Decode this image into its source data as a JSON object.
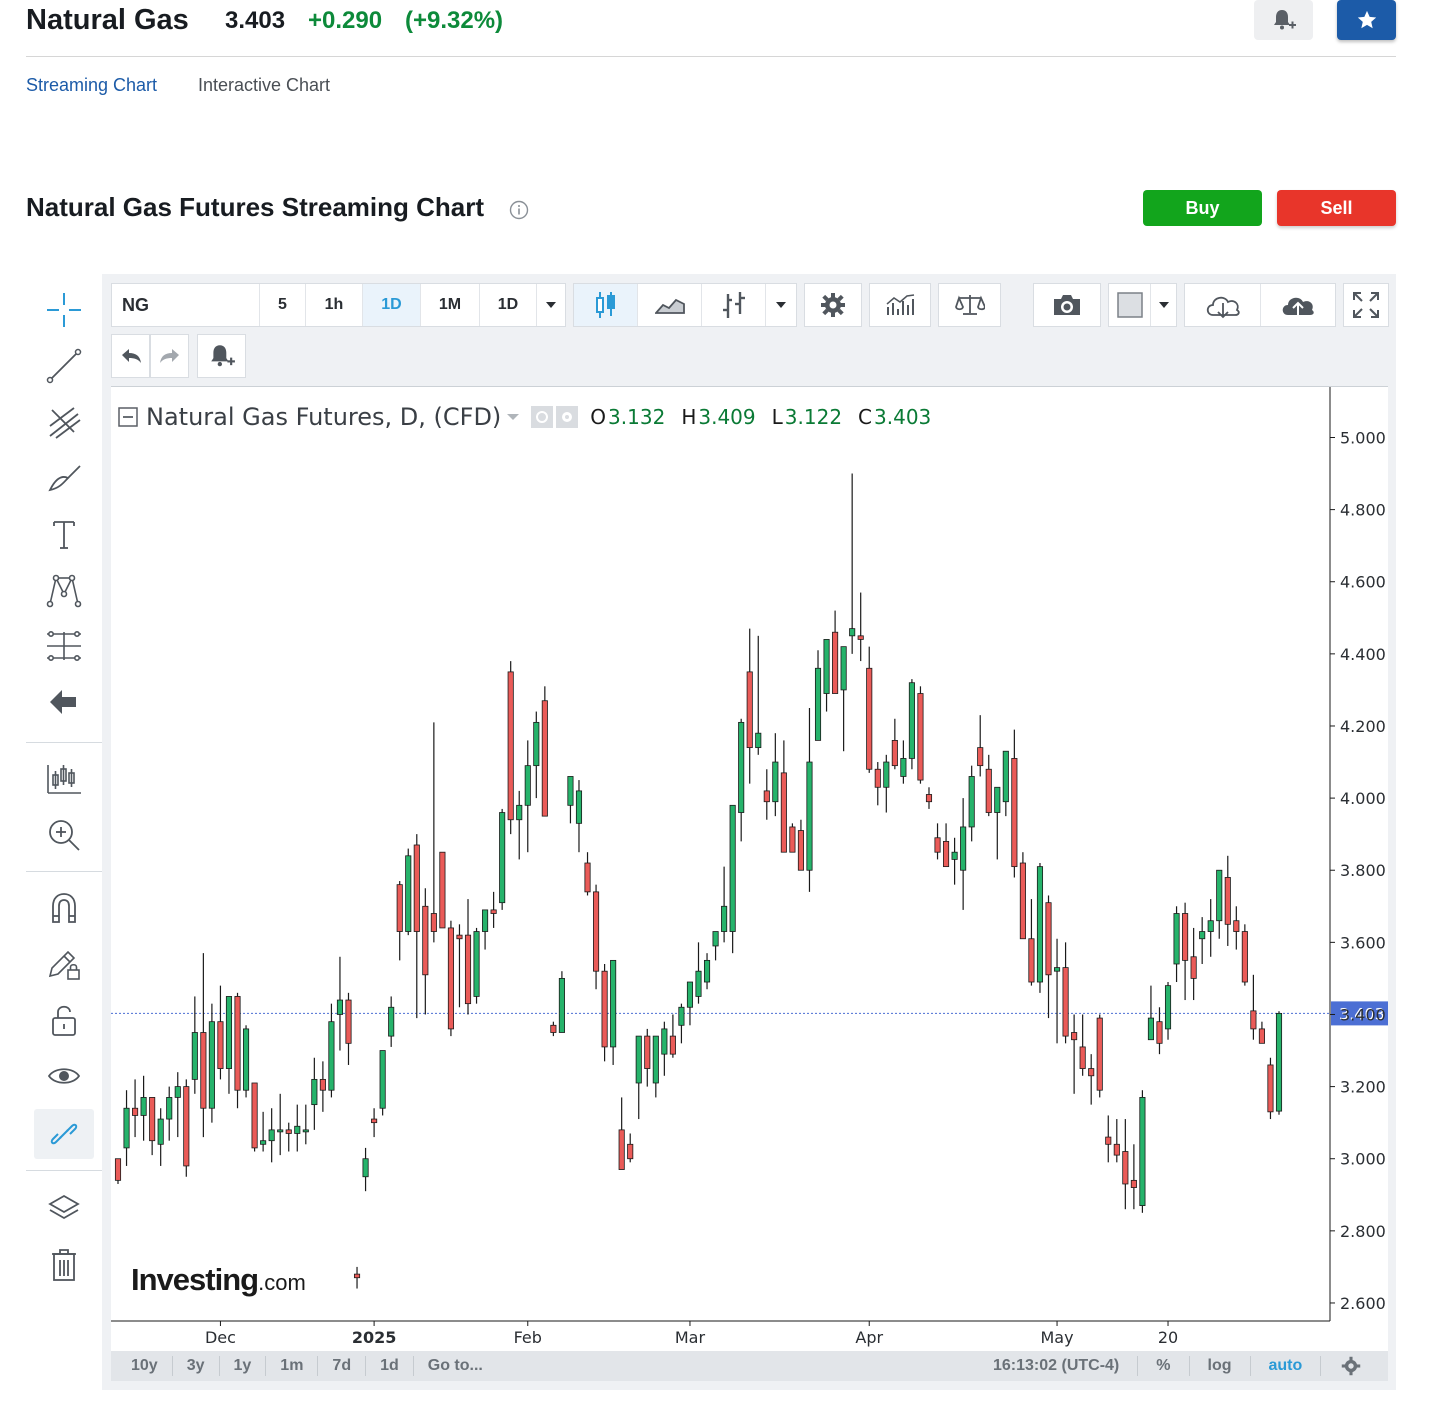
{
  "header": {
    "title": "Natural Gas",
    "price": "3.403",
    "change": "+0.290",
    "change_pct": "(+9.32%)"
  },
  "tabs": [
    {
      "label": "Streaming Chart",
      "active": true
    },
    {
      "label": "Interactive Chart",
      "active": false
    }
  ],
  "section": {
    "title": "Natural Gas Futures Streaming Chart",
    "buy_label": "Buy",
    "sell_label": "Sell"
  },
  "toolbar": {
    "symbol": "NG",
    "intervals": [
      "5",
      "1h",
      "1D",
      "1M",
      "1D"
    ],
    "active_interval": "1D"
  },
  "legend": {
    "title": "Natural Gas Futures, D, (CFD)",
    "o_label": "O",
    "o_value": "3.132",
    "h_label": "H",
    "h_value": "3.409",
    "l_label": "L",
    "l_value": "3.122",
    "c_label": "C",
    "c_value": "3.403"
  },
  "chart_data": {
    "type": "candlestick",
    "y_ticks": [
      "5.000",
      "4.800",
      "4.600",
      "4.400",
      "4.200",
      "4.000",
      "3.800",
      "3.600",
      "3.400",
      "3.200",
      "3.000",
      "2.800",
      "2.600"
    ],
    "x_ticks": [
      "Dec",
      "2025",
      "Feb",
      "Mar",
      "Apr",
      "May",
      "20"
    ],
    "ylim": [
      2.55,
      5.14
    ],
    "last_price": "3.403",
    "colors": {
      "up": "#26b36b",
      "down": "#ea5b58",
      "price_line": "#4c6fd4"
    },
    "candles": [
      {
        "o": 3.0,
        "h": 3.0,
        "l": 2.93,
        "c": 2.94
      },
      {
        "o": 3.03,
        "h": 3.19,
        "l": 2.98,
        "c": 3.14
      },
      {
        "o": 3.14,
        "h": 3.22,
        "l": 3.06,
        "c": 3.12
      },
      {
        "o": 3.12,
        "h": 3.23,
        "l": 3.05,
        "c": 3.17
      },
      {
        "o": 3.17,
        "h": 3.17,
        "l": 3.01,
        "c": 3.05
      },
      {
        "o": 3.04,
        "h": 3.14,
        "l": 2.98,
        "c": 3.11
      },
      {
        "o": 3.11,
        "h": 3.2,
        "l": 3.05,
        "c": 3.17
      },
      {
        "o": 3.17,
        "h": 3.24,
        "l": 3.06,
        "c": 3.2
      },
      {
        "o": 3.2,
        "h": 3.22,
        "l": 2.95,
        "c": 2.98
      },
      {
        "o": 3.22,
        "h": 3.45,
        "l": 3.18,
        "c": 3.35
      },
      {
        "o": 3.35,
        "h": 3.57,
        "l": 3.06,
        "c": 3.14
      },
      {
        "o": 3.14,
        "h": 3.43,
        "l": 3.1,
        "c": 3.38
      },
      {
        "o": 3.38,
        "h": 3.48,
        "l": 3.22,
        "c": 3.25
      },
      {
        "o": 3.25,
        "h": 3.45,
        "l": 3.18,
        "c": 3.45
      },
      {
        "o": 3.45,
        "h": 3.46,
        "l": 3.14,
        "c": 3.19
      },
      {
        "o": 3.19,
        "h": 3.37,
        "l": 3.17,
        "c": 3.36
      },
      {
        "o": 3.21,
        "h": 3.21,
        "l": 3.02,
        "c": 3.03
      },
      {
        "o": 3.04,
        "h": 3.13,
        "l": 3.02,
        "c": 3.05
      },
      {
        "o": 3.05,
        "h": 3.14,
        "l": 2.99,
        "c": 3.08
      },
      {
        "o": 3.08,
        "h": 3.18,
        "l": 3.01,
        "c": 3.08
      },
      {
        "o": 3.08,
        "h": 3.1,
        "l": 3.02,
        "c": 3.07
      },
      {
        "o": 3.07,
        "h": 3.15,
        "l": 3.02,
        "c": 3.09
      },
      {
        "o": 3.08,
        "h": 3.15,
        "l": 3.04,
        "c": 3.08
      },
      {
        "o": 3.15,
        "h": 3.28,
        "l": 3.08,
        "c": 3.22
      },
      {
        "o": 3.22,
        "h": 3.27,
        "l": 3.13,
        "c": 3.19
      },
      {
        "o": 3.19,
        "h": 3.43,
        "l": 3.17,
        "c": 3.38
      },
      {
        "o": 3.4,
        "h": 3.56,
        "l": 3.3,
        "c": 3.44
      },
      {
        "o": 3.44,
        "h": 3.46,
        "l": 3.26,
        "c": 3.32
      },
      {
        "o": 2.68,
        "h": 2.7,
        "l": 2.64,
        "c": 2.67
      },
      {
        "o": 2.95,
        "h": 3.03,
        "l": 2.91,
        "c": 3.0
      },
      {
        "o": 3.11,
        "h": 3.14,
        "l": 3.06,
        "c": 3.1
      },
      {
        "o": 3.14,
        "h": 3.3,
        "l": 3.12,
        "c": 3.3
      },
      {
        "o": 3.34,
        "h": 3.45,
        "l": 3.31,
        "c": 3.42
      },
      {
        "o": 3.76,
        "h": 3.77,
        "l": 3.55,
        "c": 3.63
      },
      {
        "o": 3.63,
        "h": 3.86,
        "l": 3.62,
        "c": 3.84
      },
      {
        "o": 3.87,
        "h": 3.9,
        "l": 3.39,
        "c": 3.63
      },
      {
        "o": 3.7,
        "h": 3.75,
        "l": 3.4,
        "c": 3.51
      },
      {
        "o": 3.68,
        "h": 4.21,
        "l": 3.6,
        "c": 3.63
      },
      {
        "o": 3.85,
        "h": 3.85,
        "l": 3.66,
        "c": 3.64
      },
      {
        "o": 3.64,
        "h": 3.66,
        "l": 3.34,
        "c": 3.36
      },
      {
        "o": 3.62,
        "h": 3.65,
        "l": 3.42,
        "c": 3.61
      },
      {
        "o": 3.62,
        "h": 3.72,
        "l": 3.4,
        "c": 3.43
      },
      {
        "o": 3.45,
        "h": 3.64,
        "l": 3.43,
        "c": 3.63
      },
      {
        "o": 3.63,
        "h": 3.64,
        "l": 3.58,
        "c": 3.69
      },
      {
        "o": 3.69,
        "h": 3.74,
        "l": 3.64,
        "c": 3.68
      },
      {
        "o": 3.71,
        "h": 3.97,
        "l": 3.69,
        "c": 3.96
      },
      {
        "o": 4.35,
        "h": 4.38,
        "l": 3.9,
        "c": 3.94
      },
      {
        "o": 3.94,
        "h": 4.02,
        "l": 3.83,
        "c": 3.98
      },
      {
        "o": 3.98,
        "h": 4.16,
        "l": 3.85,
        "c": 4.09
      },
      {
        "o": 4.09,
        "h": 4.24,
        "l": 4.0,
        "c": 4.21
      },
      {
        "o": 4.27,
        "h": 4.31,
        "l": 3.96,
        "c": 3.95
      },
      {
        "o": 3.37,
        "h": 3.38,
        "l": 3.34,
        "c": 3.35
      },
      {
        "o": 3.35,
        "h": 3.52,
        "l": 3.35,
        "c": 3.5
      },
      {
        "o": 3.98,
        "h": 4.05,
        "l": 3.93,
        "c": 4.06
      },
      {
        "o": 3.93,
        "h": 4.05,
        "l": 3.85,
        "c": 4.02
      },
      {
        "o": 3.82,
        "h": 3.85,
        "l": 3.73,
        "c": 3.74
      },
      {
        "o": 3.74,
        "h": 3.76,
        "l": 3.47,
        "c": 3.52
      },
      {
        "o": 3.52,
        "h": 3.54,
        "l": 3.27,
        "c": 3.31
      },
      {
        "o": 3.31,
        "h": 3.54,
        "l": 3.26,
        "c": 3.55
      },
      {
        "o": 3.08,
        "h": 3.17,
        "l": 3.03,
        "c": 2.97
      },
      {
        "o": 3.04,
        "h": 3.07,
        "l": 2.99,
        "c": 3.0
      },
      {
        "o": 3.21,
        "h": 3.26,
        "l": 3.11,
        "c": 3.34
      },
      {
        "o": 3.34,
        "h": 3.36,
        "l": 3.2,
        "c": 3.25
      },
      {
        "o": 3.21,
        "h": 3.34,
        "l": 3.17,
        "c": 3.34
      },
      {
        "o": 3.29,
        "h": 3.38,
        "l": 3.23,
        "c": 3.36
      },
      {
        "o": 3.34,
        "h": 3.4,
        "l": 3.28,
        "c": 3.29
      },
      {
        "o": 3.37,
        "h": 3.43,
        "l": 3.32,
        "c": 3.42
      },
      {
        "o": 3.42,
        "h": 3.45,
        "l": 3.37,
        "c": 3.49
      },
      {
        "o": 3.45,
        "h": 3.6,
        "l": 3.43,
        "c": 3.52
      },
      {
        "o": 3.49,
        "h": 3.57,
        "l": 3.47,
        "c": 3.55
      },
      {
        "o": 3.59,
        "h": 3.62,
        "l": 3.55,
        "c": 3.63
      },
      {
        "o": 3.63,
        "h": 3.81,
        "l": 3.6,
        "c": 3.7
      },
      {
        "o": 3.63,
        "h": 3.84,
        "l": 3.57,
        "c": 3.98
      },
      {
        "o": 3.96,
        "h": 4.22,
        "l": 3.88,
        "c": 4.21
      },
      {
        "o": 4.35,
        "h": 4.47,
        "l": 4.04,
        "c": 4.14
      },
      {
        "o": 4.14,
        "h": 4.45,
        "l": 4.12,
        "c": 4.18
      },
      {
        "o": 4.02,
        "h": 4.08,
        "l": 3.94,
        "c": 3.99
      },
      {
        "o": 3.99,
        "h": 4.18,
        "l": 3.95,
        "c": 4.1
      },
      {
        "o": 4.07,
        "h": 4.16,
        "l": 3.85,
        "c": 3.85
      },
      {
        "o": 3.92,
        "h": 3.93,
        "l": 3.89,
        "c": 3.85
      },
      {
        "o": 3.91,
        "h": 3.94,
        "l": 3.81,
        "c": 3.8
      },
      {
        "o": 3.8,
        "h": 4.25,
        "l": 3.74,
        "c": 4.1
      },
      {
        "o": 4.16,
        "h": 4.41,
        "l": 4.16,
        "c": 4.36
      },
      {
        "o": 4.29,
        "h": 4.41,
        "l": 4.24,
        "c": 4.44
      },
      {
        "o": 4.46,
        "h": 4.52,
        "l": 4.3,
        "c": 4.29
      },
      {
        "o": 4.3,
        "h": 4.41,
        "l": 4.13,
        "c": 4.42
      },
      {
        "o": 4.45,
        "h": 4.9,
        "l": 4.4,
        "c": 4.47
      },
      {
        "o": 4.45,
        "h": 4.57,
        "l": 4.38,
        "c": 4.44
      },
      {
        "o": 4.36,
        "h": 4.42,
        "l": 4.07,
        "c": 4.08
      },
      {
        "o": 4.08,
        "h": 4.1,
        "l": 3.98,
        "c": 4.03
      },
      {
        "o": 4.03,
        "h": 4.12,
        "l": 3.96,
        "c": 4.1
      },
      {
        "o": 4.16,
        "h": 4.22,
        "l": 4.08,
        "c": 4.09
      },
      {
        "o": 4.06,
        "h": 4.16,
        "l": 4.04,
        "c": 4.11
      },
      {
        "o": 4.11,
        "h": 4.33,
        "l": 4.08,
        "c": 4.32
      },
      {
        "o": 4.29,
        "h": 4.31,
        "l": 4.04,
        "c": 4.05
      },
      {
        "o": 4.01,
        "h": 4.03,
        "l": 3.97,
        "c": 3.99
      },
      {
        "o": 3.89,
        "h": 3.93,
        "l": 3.83,
        "c": 3.85
      },
      {
        "o": 3.88,
        "h": 3.93,
        "l": 3.81,
        "c": 3.81
      },
      {
        "o": 3.83,
        "h": 3.89,
        "l": 3.76,
        "c": 3.85
      },
      {
        "o": 3.8,
        "h": 4.0,
        "l": 3.69,
        "c": 3.92
      },
      {
        "o": 3.92,
        "h": 4.09,
        "l": 3.88,
        "c": 4.06
      },
      {
        "o": 4.14,
        "h": 4.23,
        "l": 4.06,
        "c": 4.09
      },
      {
        "o": 4.08,
        "h": 4.12,
        "l": 3.95,
        "c": 3.96
      },
      {
        "o": 3.96,
        "h": 4.0,
        "l": 3.83,
        "c": 4.03
      },
      {
        "o": 3.99,
        "h": 4.08,
        "l": 3.95,
        "c": 4.13
      },
      {
        "o": 4.11,
        "h": 4.19,
        "l": 3.78,
        "c": 3.81
      },
      {
        "o": 3.82,
        "h": 3.85,
        "l": 3.61,
        "c": 3.61
      },
      {
        "o": 3.61,
        "h": 3.72,
        "l": 3.48,
        "c": 3.49
      },
      {
        "o": 3.49,
        "h": 3.82,
        "l": 3.46,
        "c": 3.81
      },
      {
        "o": 3.71,
        "h": 3.73,
        "l": 3.39,
        "c": 3.51
      },
      {
        "o": 3.52,
        "h": 3.61,
        "l": 3.32,
        "c": 3.53
      },
      {
        "o": 3.53,
        "h": 3.6,
        "l": 3.32,
        "c": 3.34
      },
      {
        "o": 3.35,
        "h": 3.4,
        "l": 3.18,
        "c": 3.33
      },
      {
        "o": 3.31,
        "h": 3.4,
        "l": 3.23,
        "c": 3.25
      },
      {
        "o": 3.25,
        "h": 3.29,
        "l": 3.15,
        "c": 3.23
      },
      {
        "o": 3.39,
        "h": 3.4,
        "l": 3.17,
        "c": 3.19
      },
      {
        "o": 3.06,
        "h": 3.12,
        "l": 2.99,
        "c": 3.04
      },
      {
        "o": 3.04,
        "h": 3.11,
        "l": 2.99,
        "c": 3.01
      },
      {
        "o": 3.02,
        "h": 3.11,
        "l": 2.86,
        "c": 2.93
      },
      {
        "o": 2.94,
        "h": 3.04,
        "l": 2.86,
        "c": 2.92
      },
      {
        "o": 2.87,
        "h": 3.19,
        "l": 2.85,
        "c": 3.17
      },
      {
        "o": 3.33,
        "h": 3.48,
        "l": 3.33,
        "c": 3.39
      },
      {
        "o": 3.38,
        "h": 3.42,
        "l": 3.29,
        "c": 3.32
      },
      {
        "o": 3.36,
        "h": 3.49,
        "l": 3.33,
        "c": 3.48
      },
      {
        "o": 3.54,
        "h": 3.7,
        "l": 3.49,
        "c": 3.68
      },
      {
        "o": 3.68,
        "h": 3.71,
        "l": 3.44,
        "c": 3.55
      },
      {
        "o": 3.56,
        "h": 3.64,
        "l": 3.44,
        "c": 3.5
      },
      {
        "o": 3.61,
        "h": 3.67,
        "l": 3.54,
        "c": 3.63
      },
      {
        "o": 3.63,
        "h": 3.72,
        "l": 3.56,
        "c": 3.66
      },
      {
        "o": 3.66,
        "h": 3.8,
        "l": 3.61,
        "c": 3.8
      },
      {
        "o": 3.78,
        "h": 3.84,
        "l": 3.59,
        "c": 3.65
      },
      {
        "o": 3.66,
        "h": 3.7,
        "l": 3.58,
        "c": 3.63
      },
      {
        "o": 3.63,
        "h": 3.65,
        "l": 3.48,
        "c": 3.49
      },
      {
        "o": 3.41,
        "h": 3.51,
        "l": 3.33,
        "c": 3.36
      },
      {
        "o": 3.36,
        "h": 3.38,
        "l": 3.32,
        "c": 3.32
      },
      {
        "o": 3.26,
        "h": 3.28,
        "l": 3.11,
        "c": 3.13
      },
      {
        "o": 3.132,
        "h": 3.409,
        "l": 3.122,
        "c": 3.403
      }
    ]
  },
  "timebar": {
    "ranges": [
      "10y",
      "3y",
      "1y",
      "1m",
      "7d",
      "1d",
      "Go to..."
    ],
    "time": "16:13:02 (UTC-4)",
    "percent_label": "%",
    "log_label": "log",
    "auto_label": "auto"
  },
  "watermark": {
    "brand": "Investing",
    "suffix": ".com"
  }
}
